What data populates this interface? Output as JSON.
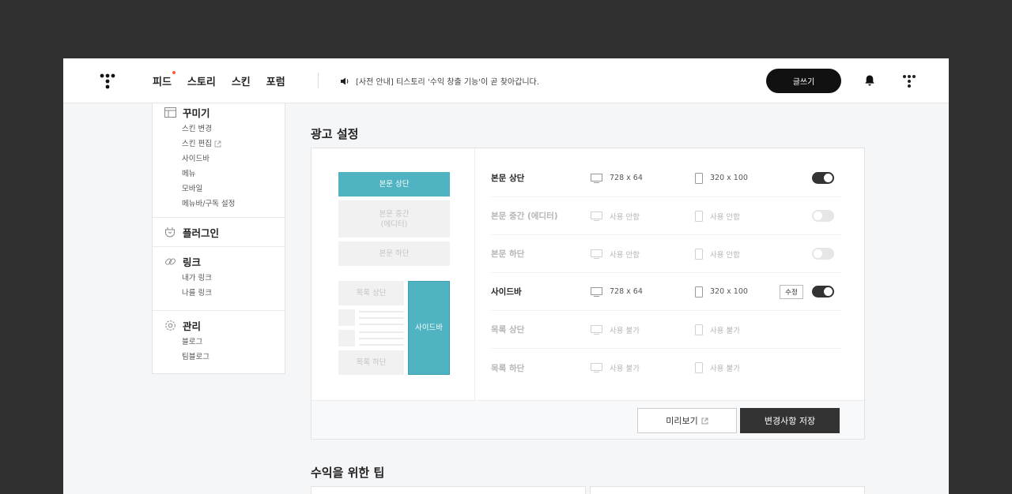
{
  "header": {
    "nav": [
      "피드",
      "스토리",
      "스킨",
      "포럼"
    ],
    "notice": "[사전 안내] 티스토리 '수익 창출 기능'이 곧 찾아갑니다.",
    "write_label": "글쓰기"
  },
  "sidebar": {
    "groups": [
      {
        "title": "꾸미기",
        "icon": "layout-icon",
        "items": [
          "스킨 변경",
          "스킨 편집",
          "사이드바",
          "메뉴",
          "모바일",
          "메뉴바/구독 설정"
        ]
      },
      {
        "title": "플러그인",
        "icon": "plugin-icon",
        "items": []
      },
      {
        "title": "링크",
        "icon": "link-icon",
        "items": [
          "내가 링크",
          "나를 링크"
        ]
      },
      {
        "title": "관리",
        "icon": "gear-icon",
        "items": [
          "블로그",
          "팀블로그"
        ]
      }
    ]
  },
  "ad_settings": {
    "title": "광고 설정",
    "preview": {
      "body_top": "본문 상단",
      "body_mid_line1": "본문 중간",
      "body_mid_line2": "(에디터)",
      "body_bottom": "본문 하단",
      "list_top": "목록 상단",
      "list_bottom": "목록 하단",
      "sidebar": "사이드바"
    },
    "rows": [
      {
        "label": "본문 상단",
        "pc": "728 x 64",
        "mobile": "320 x 100",
        "enabled": true
      },
      {
        "label": "본문 중간 (에디터)",
        "pc": "사용 안함",
        "mobile": "사용 안함",
        "enabled": false
      },
      {
        "label": "본문 하단",
        "pc": "사용 안함",
        "mobile": "사용 안함",
        "enabled": false
      },
      {
        "label": "사이드바",
        "pc": "728 x 64",
        "mobile": "320 x 100",
        "enabled": true,
        "edit": "수정"
      },
      {
        "label": "목록 상단",
        "pc": "사용 불가",
        "mobile": "사용 불가"
      },
      {
        "label": "목록 하단",
        "pc": "사용 불가",
        "mobile": "사용 불가"
      }
    ],
    "preview_button": "미리보기",
    "save_button": "변경사항 저장"
  },
  "tips": {
    "title": "수익을 위한 팁"
  },
  "colors": {
    "accent": "#4fb3c1",
    "dark": "#333333",
    "notify_dot": "#ff5a3c"
  }
}
